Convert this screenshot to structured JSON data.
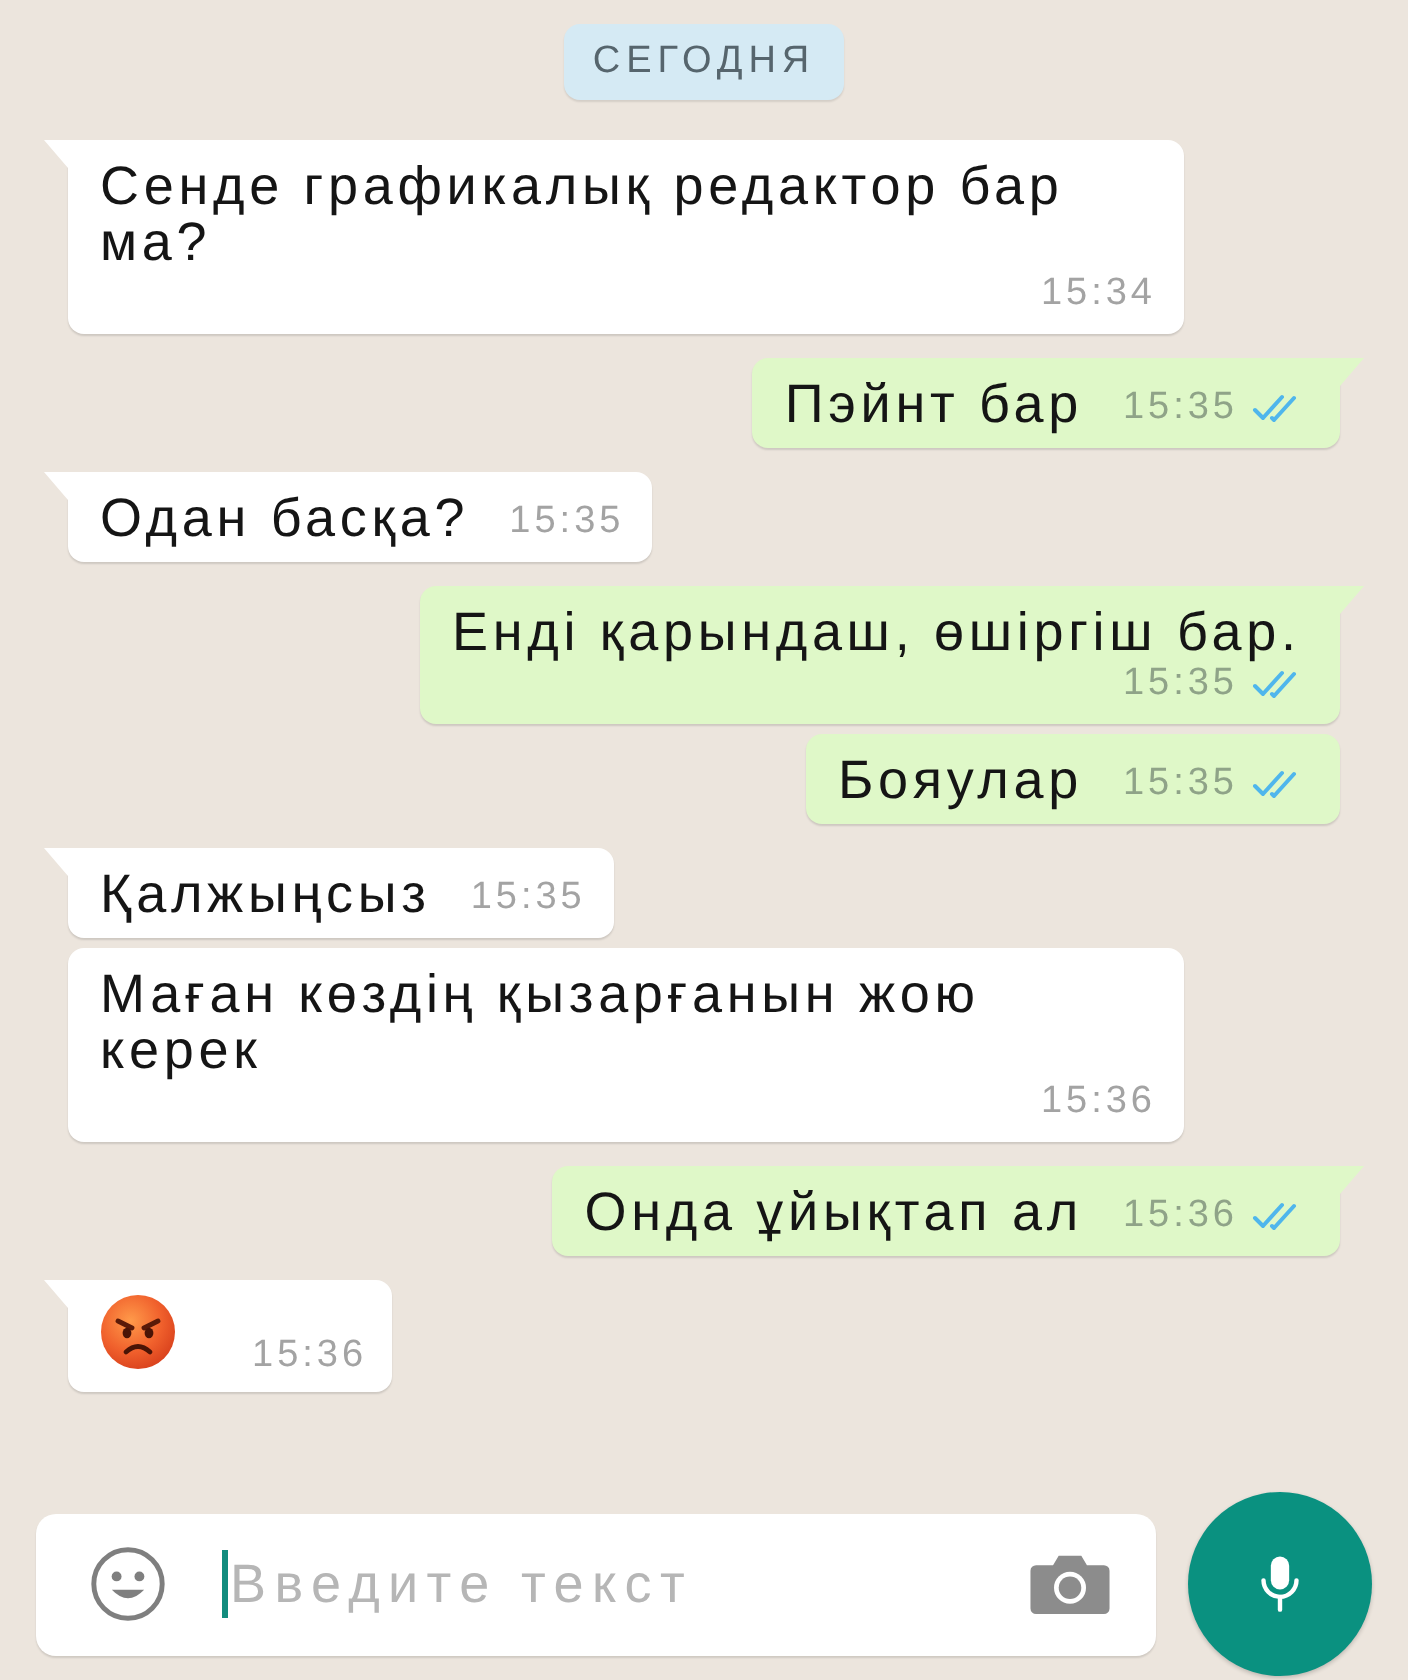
{
  "date_divider": {
    "label": "СЕГОДНЯ"
  },
  "messages": [
    {
      "outgoing": false,
      "kind": "text",
      "tail": true,
      "text": "Сенде графикалық редактор бар ма?",
      "time": "15:34"
    },
    {
      "outgoing": true,
      "kind": "text",
      "tail": true,
      "text": "Пэйнт бар",
      "time": "15:35",
      "read": true
    },
    {
      "outgoing": false,
      "kind": "text",
      "tail": true,
      "text": "Одан басқа?",
      "time": "15:35"
    },
    {
      "outgoing": true,
      "kind": "text",
      "tail": true,
      "text": "Енді қарындаш, өшіргіш бар.",
      "time": "15:35",
      "read": true
    },
    {
      "outgoing": true,
      "kind": "text",
      "tail": false,
      "text": "Бояулар",
      "time": "15:35",
      "read": true
    },
    {
      "outgoing": false,
      "kind": "text",
      "tail": true,
      "text": "Қалжыңсыз",
      "time": "15:35"
    },
    {
      "outgoing": false,
      "kind": "text",
      "tail": false,
      "text": "Маған көздің қызарғанын жою керек",
      "time": "15:36"
    },
    {
      "outgoing": true,
      "kind": "text",
      "tail": true,
      "text": "Онда ұйықтап ал",
      "time": "15:36",
      "read": true
    },
    {
      "outgoing": false,
      "kind": "emoji",
      "tail": true,
      "time": "15:36"
    }
  ],
  "composer": {
    "placeholder": "Введите текст"
  }
}
